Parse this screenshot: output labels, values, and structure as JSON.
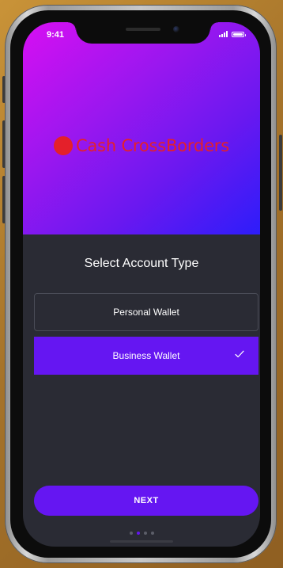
{
  "status_bar": {
    "time": "9:41"
  },
  "brand": {
    "name": "Cash CrossBorders",
    "color": "#e4202a"
  },
  "content": {
    "title": "Select Account Type",
    "options": [
      {
        "label": "Personal Wallet",
        "selected": false
      },
      {
        "label": "Business Wallet",
        "selected": true
      }
    ],
    "next_button_label": "NEXT"
  },
  "pagination": {
    "total": 4,
    "active_index": 1
  },
  "colors": {
    "accent": "#6516f2",
    "screen_background": "#2a2b34",
    "hero_gradient_start": "#d70ff2",
    "hero_gradient_end": "#2d1dfa",
    "backdrop": "#b2812e"
  },
  "icons": {
    "selected_indicator": "check-icon",
    "signal": "signal-icon",
    "battery": "battery-icon"
  }
}
